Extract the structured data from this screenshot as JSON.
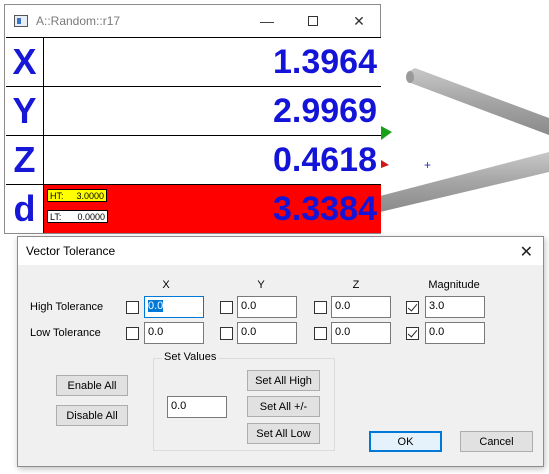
{
  "readout_window": {
    "title": "A::Random::r17",
    "controls": {
      "minimize": "—",
      "maximize": "",
      "close": "✕"
    },
    "rows": [
      {
        "axis": "X",
        "value": "1.3964"
      },
      {
        "axis": "Y",
        "value": "2.9969"
      },
      {
        "axis": "Z",
        "value": "0.4618"
      },
      {
        "axis": "d",
        "value": "3.3384"
      }
    ],
    "tolerance": {
      "ht_label": "HT:",
      "ht_value": "3.0000",
      "lt_label": "LT:",
      "lt_value": "0.0000"
    },
    "colors": {
      "value_text": "#1414d8",
      "out_of_tolerance": "#ff0000",
      "ht_badge": "#ffff00"
    }
  },
  "dialog": {
    "title": "Vector Tolerance",
    "close_label": "✕",
    "columns": [
      "X",
      "Y",
      "Z",
      "Magnitude"
    ],
    "high": {
      "label": "High Tolerance",
      "checked": [
        false,
        false,
        false,
        true
      ],
      "values": [
        "0.0",
        "0.0",
        "0.0",
        "3.0"
      ]
    },
    "low": {
      "label": "Low Tolerance",
      "checked": [
        false,
        false,
        false,
        true
      ],
      "values": [
        "0.0",
        "0.0",
        "0.0",
        "0.0"
      ]
    },
    "enable_all": "Enable All",
    "disable_all": "Disable All",
    "set_values": {
      "label": "Set Values",
      "value": "0.0",
      "set_all_high": "Set All High",
      "set_all_pm": "Set All +/-",
      "set_all_low": "Set All Low"
    },
    "ok": "OK",
    "cancel": "Cancel"
  }
}
